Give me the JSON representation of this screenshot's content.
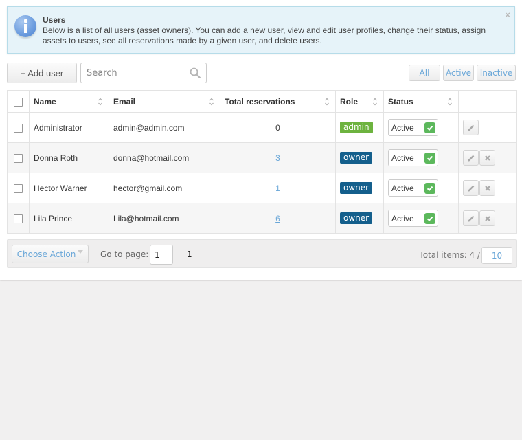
{
  "info": {
    "title": "Users",
    "text": "Below is a list of all users (asset owners). You can add a new user, view and edit user profiles, change their status, assign assets to users, see all reservations made by a given user, and delete users.",
    "icon": "info-icon",
    "close_symbol": "×"
  },
  "toolbar": {
    "add_user_label": "+ Add user",
    "search_placeholder": "Search",
    "search_value": "",
    "filters": [
      "All",
      "Active",
      "Inactive"
    ]
  },
  "table": {
    "columns": [
      "Name",
      "Email",
      "Total reservations",
      "Role",
      "Status"
    ],
    "rows": [
      {
        "name": "Administrator",
        "email": "admin@admin.com",
        "reservations": "0",
        "reservations_link": false,
        "role": "admin",
        "status": "Active",
        "deletable": false
      },
      {
        "name": "Donna Roth",
        "email": "donna@hotmail.com",
        "reservations": "3",
        "reservations_link": true,
        "role": "owner",
        "status": "Active",
        "deletable": true
      },
      {
        "name": "Hector Warner",
        "email": "hector@gmail.com",
        "reservations": "1",
        "reservations_link": true,
        "role": "owner",
        "status": "Active",
        "deletable": true
      },
      {
        "name": "Lila Prince",
        "email": "Lila@hotmail.com",
        "reservations": "6",
        "reservations_link": true,
        "role": "owner",
        "status": "Active",
        "deletable": true
      }
    ]
  },
  "footer": {
    "choose_action_label": "Choose Action",
    "goto_label": "Go to page:",
    "goto_value": "1",
    "pages": [
      "1"
    ],
    "total_label": "Total items: 4 /",
    "per_page": "10"
  },
  "colors": {
    "accent": "#6aa7d8",
    "admin_badge": "#6db33f",
    "owner_badge": "#145f8c",
    "status_check": "#5cb85c",
    "info_bg": "#e6f3f9"
  }
}
